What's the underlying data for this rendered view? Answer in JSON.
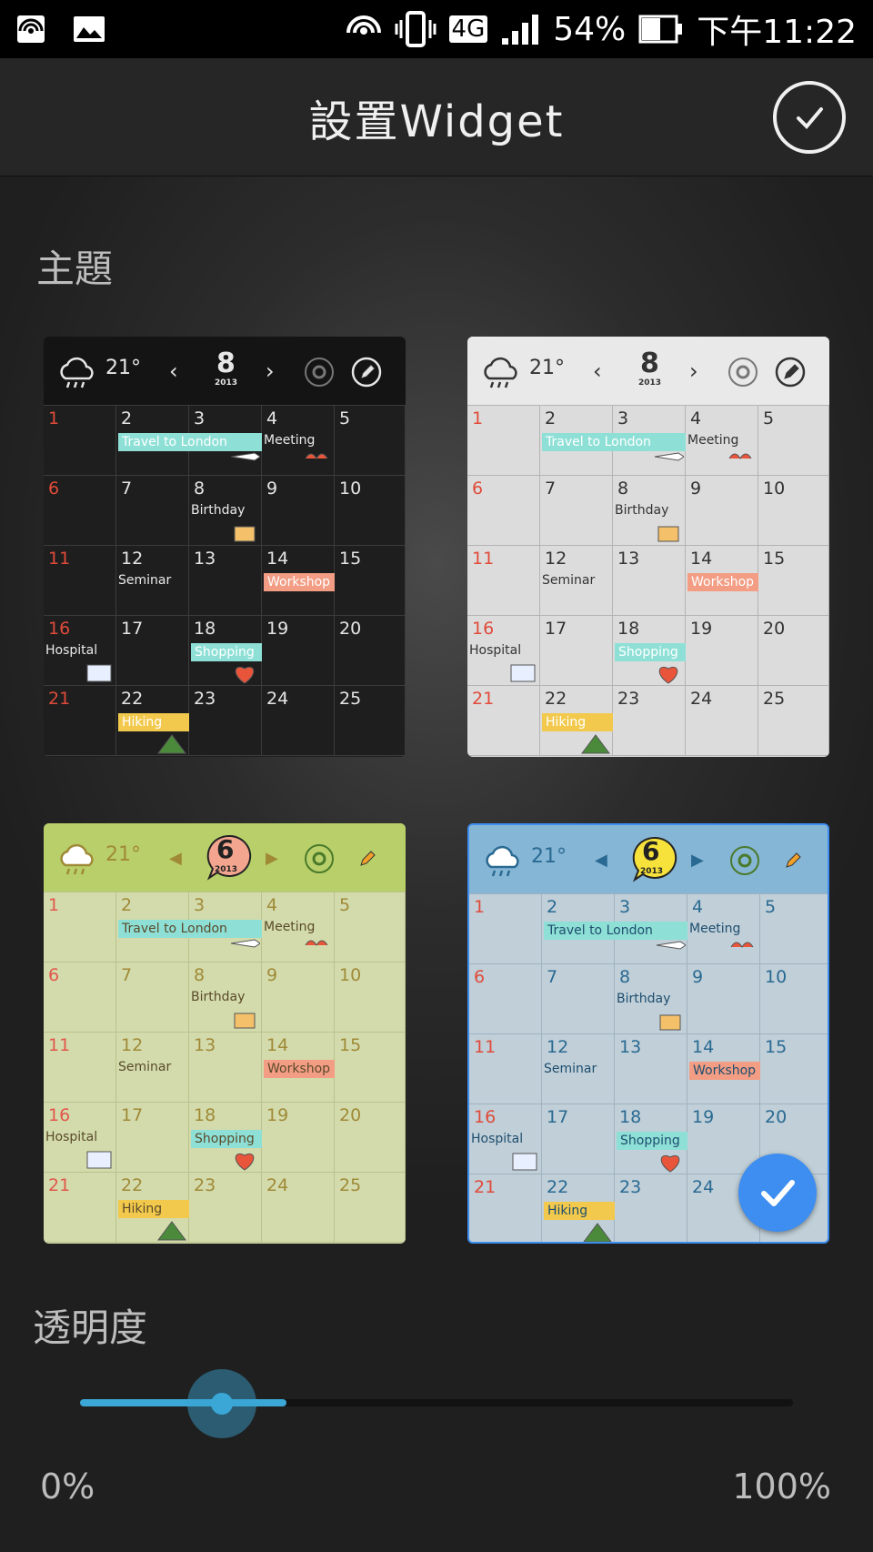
{
  "status": {
    "battery": "54%",
    "time": "下午11:22",
    "network": "4G"
  },
  "header": {
    "title": "設置Widget"
  },
  "theme_section": {
    "label": "主題"
  },
  "opacity_section": {
    "label": "透明度",
    "value_percent": 20,
    "min_label": "0%",
    "max_label": "100%"
  },
  "themes": [
    {
      "name": "dark",
      "temp": "21°",
      "month": "8",
      "year": "2013",
      "selected": false,
      "colors": {
        "bg": "#1e1e1e",
        "header": "#141414",
        "line": "#3b3b3b",
        "num": "#e6e6e6",
        "sun": "#e04b3a",
        "ev": "#eaeaea"
      }
    },
    {
      "name": "light",
      "temp": "21°",
      "month": "8",
      "year": "2013",
      "selected": false,
      "colors": {
        "bg": "#dcdcdc",
        "header": "#e9e9e9",
        "line": "#b4b4b4",
        "num": "#333333",
        "sun": "#e04b3a",
        "ev": "#333333"
      }
    },
    {
      "name": "green",
      "temp": "21°",
      "month": "6",
      "year": "2013",
      "selected": false,
      "colors": {
        "bg": "#d3dbac",
        "header": "#b8cf6a",
        "line": "#b9c28c",
        "num": "#a08a37",
        "sun": "#e2574b",
        "ev": "#5a4a2a"
      }
    },
    {
      "name": "blue",
      "temp": "21°",
      "month": "6",
      "year": "2013",
      "selected": true,
      "colors": {
        "bg": "#c0cfd8",
        "header": "#86b6d6",
        "line": "#9fb3c0",
        "num": "#2a6a92",
        "sun": "#e04b3a",
        "ev": "#1e4e6e"
      }
    }
  ],
  "calendar_days": [
    [
      "1",
      "2",
      "3",
      "4",
      "5"
    ],
    [
      "6",
      "7",
      "8",
      "9",
      "10"
    ],
    [
      "11",
      "12",
      "13",
      "14",
      "15"
    ],
    [
      "16",
      "17",
      "18",
      "19",
      "20"
    ],
    [
      "21",
      "22",
      "23",
      "24",
      "25"
    ]
  ],
  "events": {
    "travel": "Travel to London",
    "meeting": "Meeting",
    "birthday": "Birthday",
    "seminar": "Seminar",
    "workshop": "Workshop",
    "hospital": "Hospital",
    "shopping": "Shopping",
    "hiking": "Hiking"
  }
}
